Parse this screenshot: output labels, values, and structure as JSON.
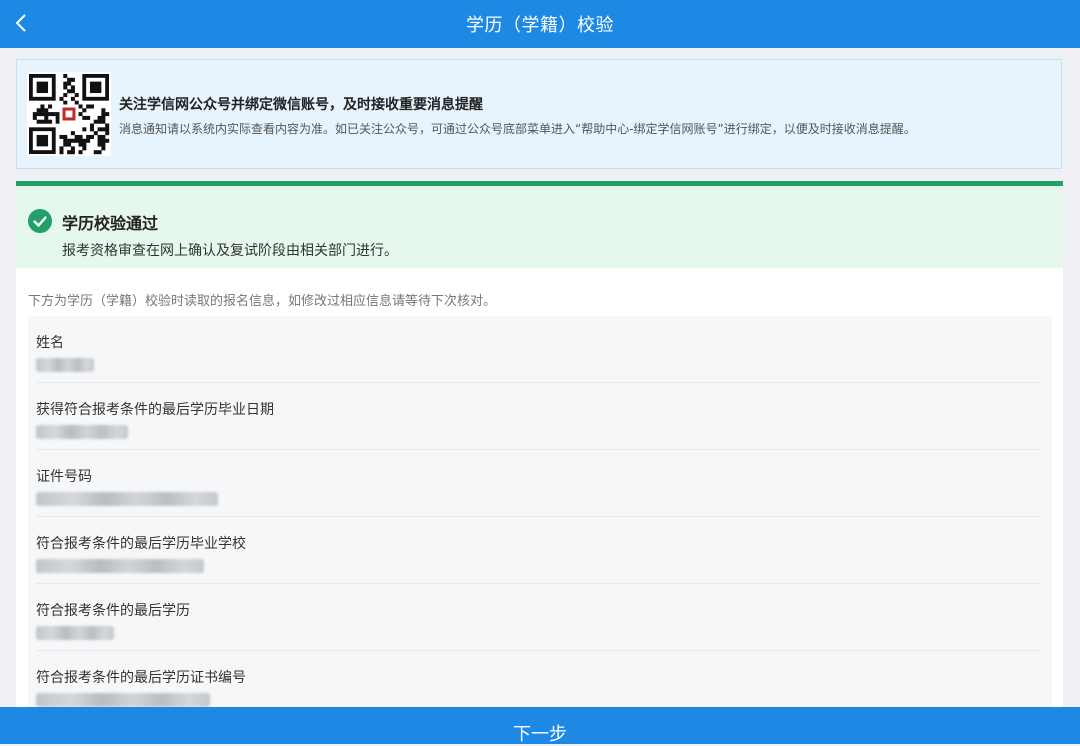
{
  "header": {
    "title": "学历（学籍）校验",
    "back_icon": "chevron-left-icon"
  },
  "notice": {
    "qr_icon": "qr-code-icon",
    "title": "关注学信网公众号并绑定微信账号，及时接收重要消息提醒",
    "description": "消息通知请以系统内实际查看内容为准。如已关注公众号，可通过公众号底部菜单进入“帮助中心-绑定学信网账号”进行绑定，以便及时接收消息提醒。"
  },
  "status": {
    "icon": "check-circle-icon",
    "title": "学历校验通过",
    "description": "报考资格审查在网上确认及复试阶段由相关部门进行。",
    "color": "#22a067"
  },
  "intro": "下方为学历（学籍）校验时读取的报名信息，如修改过相应信息请等待下次核对。",
  "fields": [
    {
      "label": "姓名"
    },
    {
      "label": "获得符合报考条件的最后学历毕业日期"
    },
    {
      "label": "证件号码"
    },
    {
      "label": "符合报考条件的最后学历毕业学校"
    },
    {
      "label": "符合报考条件的最后学历"
    },
    {
      "label": "符合报考条件的最后学历证书编号"
    }
  ],
  "footer": {
    "next_label": "下一步"
  },
  "colors": {
    "primary": "#1e88e5",
    "notice_bg": "#e7f4fd",
    "success_bg": "#e6f7ee"
  }
}
